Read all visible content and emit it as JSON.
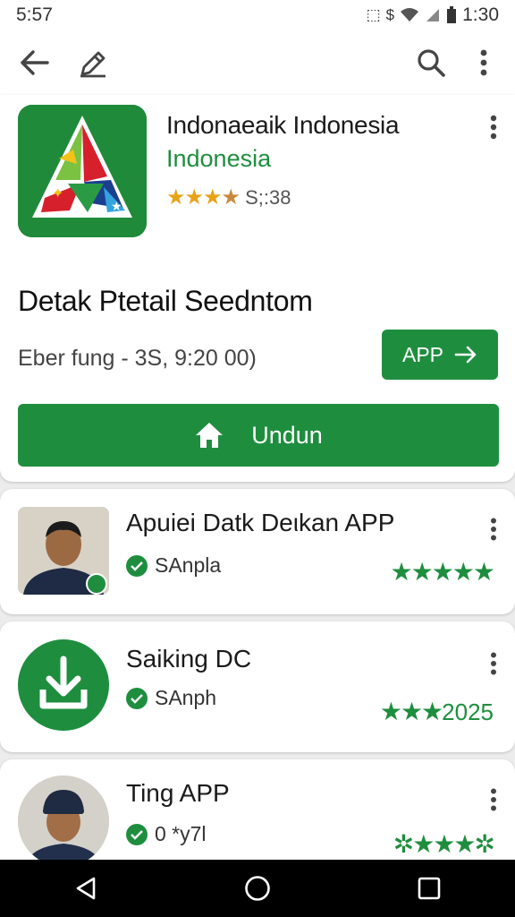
{
  "status_bar": {
    "time": "5:57",
    "battery_time": "1:30"
  },
  "header": {
    "title": "Indonaeaik Indonesia",
    "subtitle": "Indonesia",
    "rating_count": "S;:38",
    "detail_heading": "Detak Ptetail Seedntom",
    "meta": "Eber fung - 3S, 9:20 00)",
    "app_button_label": "APP",
    "primary_button_label": "Undun"
  },
  "list_items": [
    {
      "title": "Apuiei Datk Deιkan APP",
      "verified_label": "SAnpla",
      "rating": 5
    },
    {
      "title": "Saiking DC",
      "verified_label": "SAnph",
      "rating": 3,
      "rating_label": "2025"
    },
    {
      "title": "Ting APP",
      "verified_label": "0 *y7l",
      "rating": 5
    }
  ],
  "colors": {
    "accent": "#1e8e3e",
    "star_gold": "#e8a317"
  },
  "icons": [
    "back-arrow-icon",
    "edit-icon",
    "search-icon",
    "more-vert-icon",
    "home-icon",
    "arrow-right-icon",
    "download-icon",
    "verified-check-icon",
    "star-icon",
    "nav-back-icon",
    "nav-home-icon",
    "nav-recents-icon"
  ]
}
